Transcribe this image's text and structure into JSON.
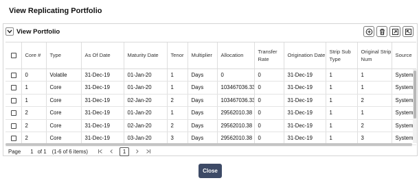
{
  "dialog": {
    "title": "View Replicating Portfolio",
    "close_label": "Close"
  },
  "panel": {
    "title": "View Portfolio",
    "toolbar_icons": [
      "add-icon",
      "delete-icon",
      "export-icon",
      "expand-icon"
    ]
  },
  "table": {
    "headers": [
      "Core #",
      "Type",
      "As Of Date",
      "Maturity Date",
      "Tenor",
      "Multiplier",
      "Allocation",
      "Transfer Rate",
      "Origination Date",
      "Strip Sub Type",
      "Original Strip Num",
      "Source"
    ],
    "rows": [
      [
        "0",
        "Volatile",
        "31-Dec-19",
        "01-Jan-20",
        "1",
        "Days",
        "0",
        "0",
        "31-Dec-19",
        "1",
        "1",
        "System"
      ],
      [
        "1",
        "Core",
        "31-Dec-19",
        "01-Jan-20",
        "1",
        "Days",
        "103467036.33",
        "0",
        "31-Dec-19",
        "1",
        "1",
        "System"
      ],
      [
        "1",
        "Core",
        "31-Dec-19",
        "02-Jan-20",
        "2",
        "Days",
        "103467036.33",
        "0",
        "31-Dec-19",
        "1",
        "2",
        "System"
      ],
      [
        "2",
        "Core",
        "31-Dec-19",
        "01-Jan-20",
        "1",
        "Days",
        "29562010.38",
        "0",
        "31-Dec-19",
        "1",
        "1",
        "System"
      ],
      [
        "2",
        "Core",
        "31-Dec-19",
        "02-Jan-20",
        "2",
        "Days",
        "29562010.38",
        "0",
        "31-Dec-19",
        "1",
        "2",
        "System"
      ],
      [
        "2",
        "Core",
        "31-Dec-19",
        "03-Jan-20",
        "3",
        "Days",
        "29562010.38",
        "0",
        "31-Dec-19",
        "1",
        "3",
        "System"
      ]
    ]
  },
  "pager": {
    "page_label": "Page",
    "page_number": "1",
    "of_label": "of 1",
    "items_info": "(1-6 of 6 items)",
    "current_page": "1",
    "first_icon": "first-page-icon",
    "prev_icon": "previous-page-icon",
    "next_icon": "next-page-icon",
    "last_icon": "last-page-icon"
  }
}
